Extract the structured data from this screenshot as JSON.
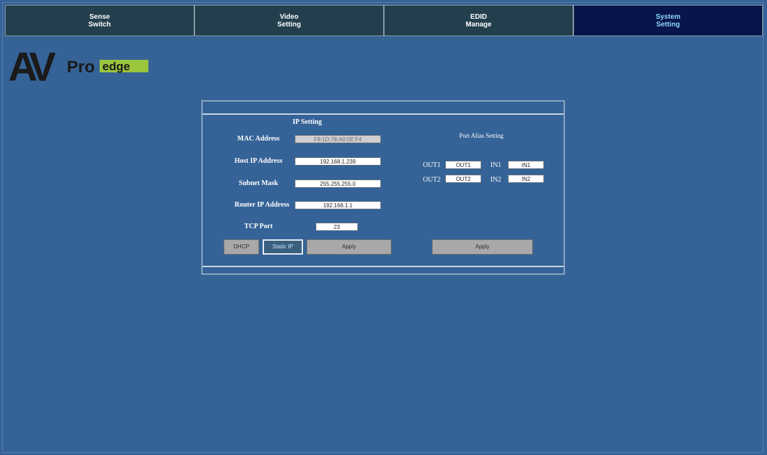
{
  "tabs": [
    {
      "line1": "Sense",
      "line2": "Switch"
    },
    {
      "line1": "Video",
      "line2": "Setting"
    },
    {
      "line1": "EDID",
      "line2": "Manage"
    },
    {
      "line1": "System",
      "line2": "Setting"
    }
  ],
  "logo": {
    "av": "AV",
    "pro": "Pro",
    "edge": "edge"
  },
  "ip_setting": {
    "title": "IP Setting",
    "mac_label": "MAC Address",
    "mac_value": "F8:1D:78:A0:0E:F4",
    "host_label": "Host IP Address",
    "host_value": "192.168.1.239",
    "subnet_label": "Subnet Mask",
    "subnet_value": "255.255.255.0",
    "router_label": "Router IP Address",
    "router_value": "192.168.1.1",
    "tcp_label": "TCP Port",
    "tcp_value": "23",
    "dhcp_label": "DHCP",
    "static_label": "Static IP",
    "apply_label": "Apply"
  },
  "port_alias": {
    "title": "Port Alias Setting",
    "out1_label": "OUT1",
    "out1_value": "OUT1",
    "in1_label": "IN1",
    "in1_value": "IN1",
    "out2_label": "OUT2",
    "out2_value": "OUT2",
    "in2_label": "IN2",
    "in2_value": "IN2",
    "apply_label": "Apply"
  },
  "colors": {
    "background": "#356397",
    "tab": "#233f4d",
    "tab_active": "#07154a",
    "tab_active_text": "#8fd8ff",
    "logo_green": "#9bc53d"
  }
}
